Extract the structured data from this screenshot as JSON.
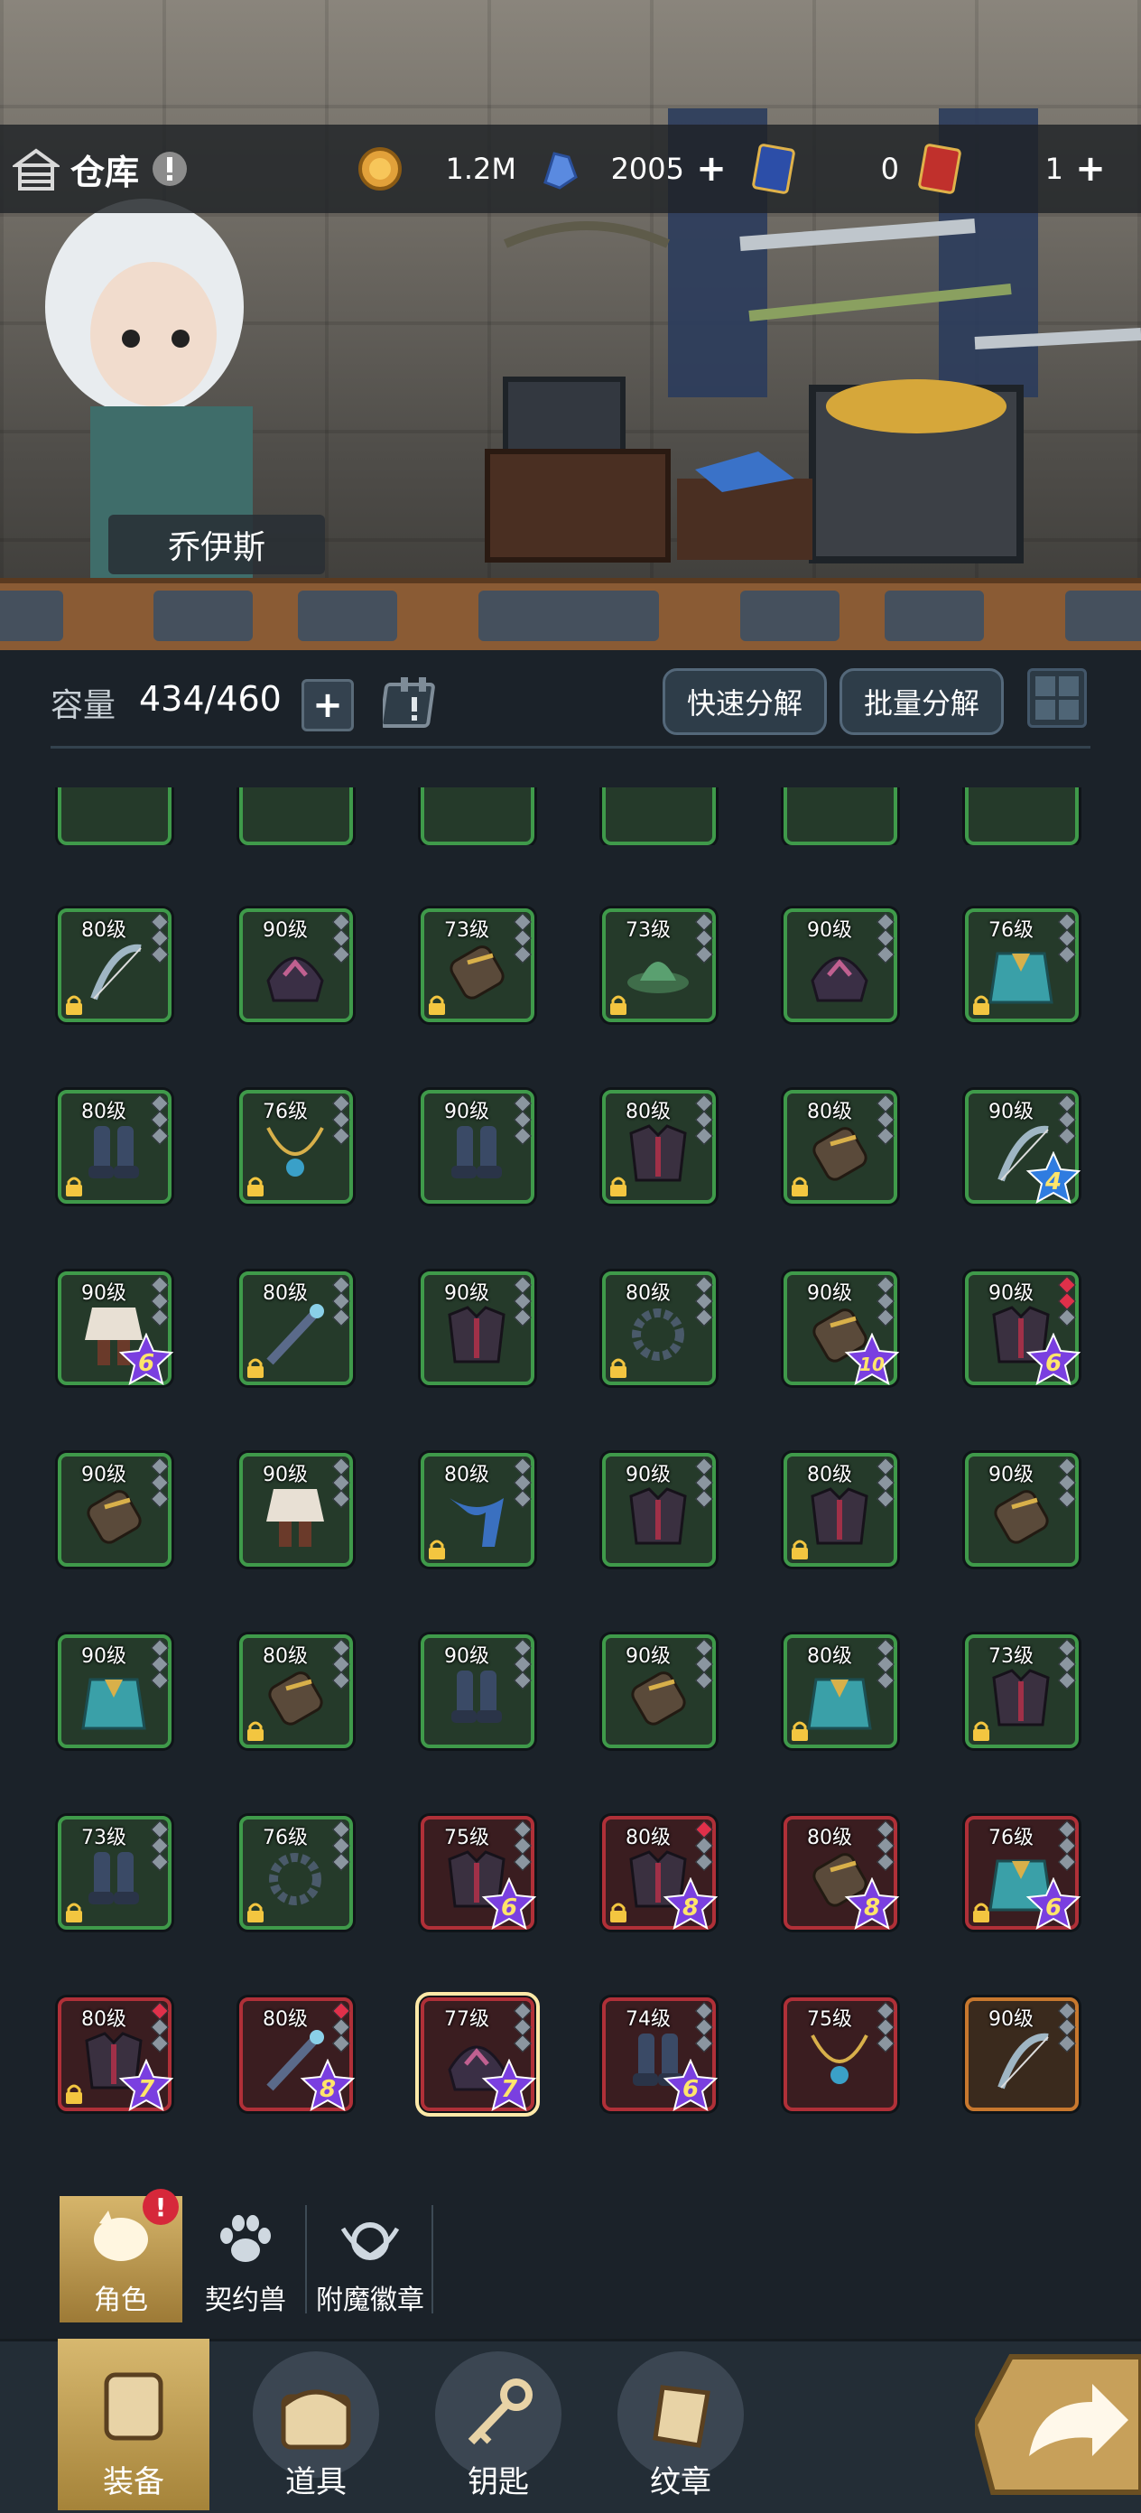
{
  "header": {
    "title": "仓库",
    "gold": "1.2M",
    "gems": "2005",
    "ticket_dai": "0",
    "ticket_jin": "1"
  },
  "hero": {
    "name": "乔伊斯"
  },
  "capacity": {
    "label": "容量",
    "value": "434/460",
    "quick_decompose": "快速分解",
    "batch_decompose": "批量分解"
  },
  "items": [
    {
      "lvl": "80级",
      "frame": "green",
      "lock": true,
      "star": "",
      "sel": false,
      "dots": [
        "g",
        "g",
        "g"
      ],
      "icon": "bow-icon"
    },
    {
      "lvl": "90级",
      "frame": "green",
      "lock": false,
      "star": "",
      "sel": false,
      "dots": [
        "g",
        "g",
        "g"
      ],
      "icon": "helmet-icon"
    },
    {
      "lvl": "73级",
      "frame": "green",
      "lock": true,
      "star": "",
      "sel": false,
      "dots": [
        "g",
        "g",
        "g"
      ],
      "icon": "bracer-icon"
    },
    {
      "lvl": "73级",
      "frame": "green",
      "lock": true,
      "star": "",
      "sel": false,
      "dots": [
        "g",
        "g",
        "g"
      ],
      "icon": "hat-icon"
    },
    {
      "lvl": "90级",
      "frame": "green",
      "lock": false,
      "star": "",
      "sel": false,
      "dots": [
        "g",
        "g",
        "g"
      ],
      "icon": "helmet-icon"
    },
    {
      "lvl": "76级",
      "frame": "green",
      "lock": true,
      "star": "",
      "sel": false,
      "dots": [
        "g",
        "g",
        "g"
      ],
      "icon": "cloak-icon"
    },
    {
      "lvl": "80级",
      "frame": "green",
      "lock": true,
      "star": "",
      "sel": false,
      "dots": [
        "g",
        "g",
        "g"
      ],
      "icon": "boots-icon"
    },
    {
      "lvl": "76级",
      "frame": "green",
      "lock": true,
      "star": "",
      "sel": false,
      "dots": [
        "g",
        "g",
        "g"
      ],
      "icon": "necklace-icon"
    },
    {
      "lvl": "90级",
      "frame": "green",
      "lock": false,
      "star": "",
      "sel": false,
      "dots": [
        "g",
        "g",
        "g"
      ],
      "icon": "boots-icon"
    },
    {
      "lvl": "80级",
      "frame": "green",
      "lock": true,
      "star": "",
      "sel": false,
      "dots": [
        "g",
        "g",
        "g"
      ],
      "icon": "armor-icon"
    },
    {
      "lvl": "80级",
      "frame": "green",
      "lock": true,
      "star": "",
      "sel": false,
      "dots": [
        "g",
        "g",
        "g"
      ],
      "icon": "bracer-icon"
    },
    {
      "lvl": "90级",
      "frame": "green",
      "lock": false,
      "star": "4",
      "starColor": "blue",
      "sel": false,
      "dots": [
        "g",
        "g",
        "g"
      ],
      "icon": "bow-icon"
    },
    {
      "lvl": "90级",
      "frame": "green",
      "lock": false,
      "star": "6",
      "starColor": "purple",
      "sel": false,
      "dots": [
        "g",
        "g",
        "g"
      ],
      "icon": "skirt-icon"
    },
    {
      "lvl": "80级",
      "frame": "green",
      "lock": true,
      "star": "",
      "sel": false,
      "dots": [
        "g",
        "g",
        "g"
      ],
      "icon": "staff-icon"
    },
    {
      "lvl": "90级",
      "frame": "green",
      "lock": false,
      "star": "",
      "sel": false,
      "dots": [
        "g",
        "g",
        "g"
      ],
      "icon": "armor-icon"
    },
    {
      "lvl": "80级",
      "frame": "green",
      "lock": true,
      "star": "",
      "sel": false,
      "dots": [
        "g",
        "g",
        "g"
      ],
      "icon": "ring-icon"
    },
    {
      "lvl": "90级",
      "frame": "green",
      "lock": false,
      "star": "10",
      "starColor": "purple",
      "sel": false,
      "dots": [
        "g",
        "g",
        "g"
      ],
      "icon": "bracer-icon"
    },
    {
      "lvl": "90级",
      "frame": "green",
      "lock": false,
      "star": "6",
      "starColor": "purple",
      "sel": false,
      "dots": [
        "r",
        "r",
        "g"
      ],
      "icon": "armor-icon"
    },
    {
      "lvl": "90级",
      "frame": "green",
      "lock": false,
      "star": "",
      "sel": false,
      "dots": [
        "g",
        "g",
        "g"
      ],
      "icon": "bracer-icon"
    },
    {
      "lvl": "90级",
      "frame": "green",
      "lock": false,
      "star": "",
      "sel": false,
      "dots": [
        "g",
        "g",
        "g"
      ],
      "icon": "skirt-icon"
    },
    {
      "lvl": "80级",
      "frame": "green",
      "lock": true,
      "star": "",
      "sel": false,
      "dots": [
        "g",
        "g",
        "g"
      ],
      "icon": "scarf-icon"
    },
    {
      "lvl": "90级",
      "frame": "green",
      "lock": false,
      "star": "",
      "sel": false,
      "dots": [
        "g",
        "g",
        "g"
      ],
      "icon": "armor-icon"
    },
    {
      "lvl": "80级",
      "frame": "green",
      "lock": true,
      "star": "",
      "sel": false,
      "dots": [
        "g",
        "g",
        "g"
      ],
      "icon": "armor-icon"
    },
    {
      "lvl": "90级",
      "frame": "green",
      "lock": false,
      "star": "",
      "sel": false,
      "dots": [
        "g",
        "g",
        "g"
      ],
      "icon": "bracer-icon"
    },
    {
      "lvl": "90级",
      "frame": "green",
      "lock": false,
      "star": "",
      "sel": false,
      "dots": [
        "g",
        "g",
        "g"
      ],
      "icon": "cloak-icon"
    },
    {
      "lvl": "80级",
      "frame": "green",
      "lock": true,
      "star": "",
      "sel": false,
      "dots": [
        "g",
        "g",
        "g"
      ],
      "icon": "bracer-icon"
    },
    {
      "lvl": "90级",
      "frame": "green",
      "lock": false,
      "star": "",
      "sel": false,
      "dots": [
        "g",
        "g",
        "g"
      ],
      "icon": "boots-icon"
    },
    {
      "lvl": "90级",
      "frame": "green",
      "lock": false,
      "star": "",
      "sel": false,
      "dots": [
        "g",
        "g",
        "g"
      ],
      "icon": "bracer-icon"
    },
    {
      "lvl": "80级",
      "frame": "green",
      "lock": true,
      "star": "",
      "sel": false,
      "dots": [
        "g",
        "g",
        "g"
      ],
      "icon": "cloak-icon"
    },
    {
      "lvl": "73级",
      "frame": "green",
      "lock": true,
      "star": "",
      "sel": false,
      "dots": [
        "g",
        "g",
        "g"
      ],
      "icon": "armor-icon"
    },
    {
      "lvl": "73级",
      "frame": "green",
      "lock": true,
      "star": "",
      "sel": false,
      "dots": [
        "g",
        "g",
        "g"
      ],
      "icon": "boots-icon"
    },
    {
      "lvl": "76级",
      "frame": "green",
      "lock": true,
      "star": "",
      "sel": false,
      "dots": [
        "g",
        "g",
        "g"
      ],
      "icon": "ring-icon"
    },
    {
      "lvl": "75级",
      "frame": "red",
      "lock": false,
      "star": "6",
      "starColor": "purple",
      "sel": false,
      "dots": [
        "g",
        "g",
        "g"
      ],
      "icon": "armor-icon"
    },
    {
      "lvl": "80级",
      "frame": "red",
      "lock": true,
      "star": "8",
      "starColor": "purple",
      "sel": false,
      "dots": [
        "r",
        "g",
        "g"
      ],
      "icon": "armor-icon"
    },
    {
      "lvl": "80级",
      "frame": "red",
      "lock": false,
      "star": "8",
      "starColor": "purple",
      "sel": false,
      "dots": [
        "g",
        "g",
        "g"
      ],
      "icon": "bracer-icon"
    },
    {
      "lvl": "76级",
      "frame": "red",
      "lock": true,
      "star": "6",
      "starColor": "purple",
      "sel": false,
      "dots": [
        "g",
        "g",
        "g"
      ],
      "icon": "cloak-icon"
    },
    {
      "lvl": "80级",
      "frame": "red",
      "lock": true,
      "star": "7",
      "starColor": "purple",
      "sel": false,
      "dots": [
        "r",
        "g",
        "g"
      ],
      "icon": "armor-icon"
    },
    {
      "lvl": "80级",
      "frame": "red",
      "lock": false,
      "star": "8",
      "starColor": "purple",
      "sel": false,
      "dots": [
        "r",
        "g",
        "g"
      ],
      "icon": "staff-icon"
    },
    {
      "lvl": "77级",
      "frame": "red",
      "lock": false,
      "star": "7",
      "starColor": "purple",
      "sel": true,
      "dots": [
        "g",
        "g",
        "g"
      ],
      "icon": "helmet-icon"
    },
    {
      "lvl": "74级",
      "frame": "red",
      "lock": false,
      "star": "6",
      "starColor": "purple",
      "sel": false,
      "dots": [
        "g",
        "g",
        "g"
      ],
      "icon": "boots-icon"
    },
    {
      "lvl": "75级",
      "frame": "red",
      "lock": false,
      "star": "",
      "sel": false,
      "dots": [
        "g",
        "g",
        "g"
      ],
      "icon": "necklace-icon"
    },
    {
      "lvl": "90级",
      "frame": "orange",
      "lock": false,
      "star": "",
      "sel": false,
      "dots": [
        "g",
        "g",
        "g"
      ],
      "icon": "bow-icon"
    }
  ],
  "tabs": [
    {
      "label": "角色",
      "active": true,
      "badge": "!"
    },
    {
      "label": "契约兽",
      "active": false
    },
    {
      "label": "附魔徽章",
      "active": false
    }
  ],
  "nav": [
    {
      "label": "装备",
      "active": true
    },
    {
      "label": "道具",
      "active": false
    },
    {
      "label": "钥匙",
      "active": false
    },
    {
      "label": "纹章",
      "active": false
    }
  ],
  "colors": {
    "frame_green": "#3f9a4a",
    "frame_red": "#b03038",
    "frame_orange": "#c8782e",
    "star_purple": "#7a3fe0",
    "star_blue": "#2f7ce0"
  }
}
